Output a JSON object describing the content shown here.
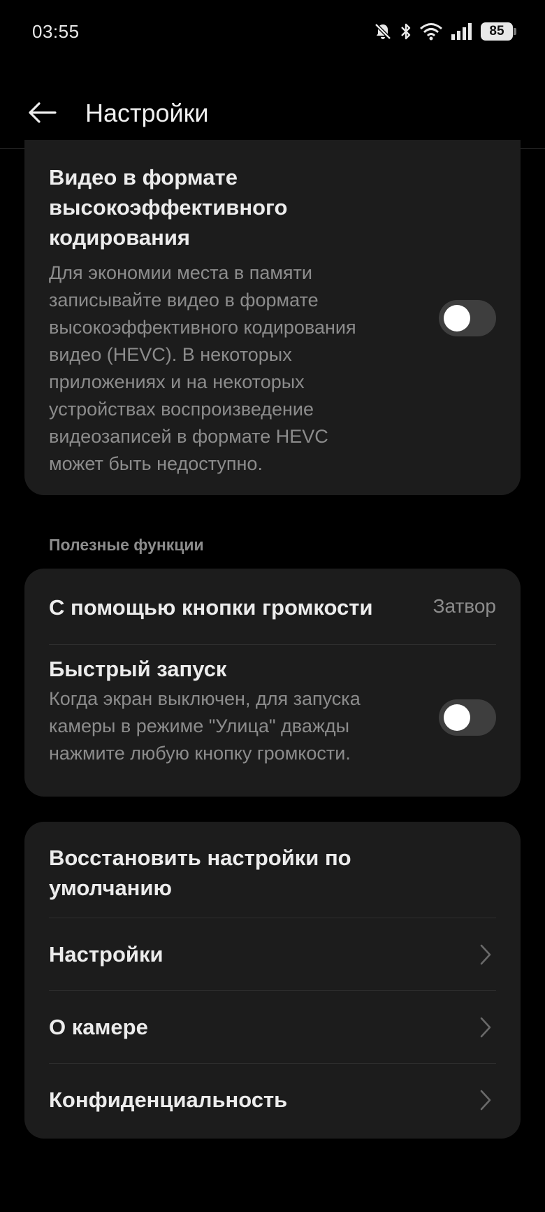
{
  "status_bar": {
    "time": "03:55",
    "battery": "85",
    "icons": [
      "bell-off-icon",
      "bluetooth-icon",
      "wifi-icon",
      "signal-icon",
      "battery-icon"
    ]
  },
  "header": {
    "title": "Настройки",
    "back_icon": "arrow-left-icon"
  },
  "hevc": {
    "title_lines": [
      "Видео в формате",
      "высокоэффективного",
      "кодирования"
    ],
    "description_lines": [
      "Для экономии места в памяти",
      "записывайте видео в формате",
      "высокоэффективного кодирования",
      "видео (HEVC). В некоторых",
      "приложениях и на некоторых",
      "устройствах воспроизведение",
      "видеозаписей в формате HEVC",
      "может быть недоступно."
    ],
    "toggle_on": false
  },
  "useful_section": {
    "header": "Полезные функции",
    "volume_button": {
      "title": "С помощью кнопки громкости",
      "value": "Затвор"
    },
    "quick_launch": {
      "title": "Быстрый запуск",
      "description_lines": [
        "Когда экран выключен, для запуска",
        "камеры в режиме \"Улица\" дважды",
        "нажмите любую кнопку громкости."
      ],
      "toggle_on": false
    }
  },
  "misc_section": {
    "restore_lines": [
      "Восстановить настройки по",
      "умолчанию"
    ],
    "settings": "Настройки",
    "about_camera": "О камере",
    "privacy": "Конфиденциальность",
    "chevron_icon": "chevron-right-icon"
  },
  "colors": {
    "background": "#000000",
    "card": "#1c1c1c",
    "primary_text": "#ececec",
    "secondary_text": "#8c8c8c",
    "toggle_track_off": "#3e3e3e"
  }
}
